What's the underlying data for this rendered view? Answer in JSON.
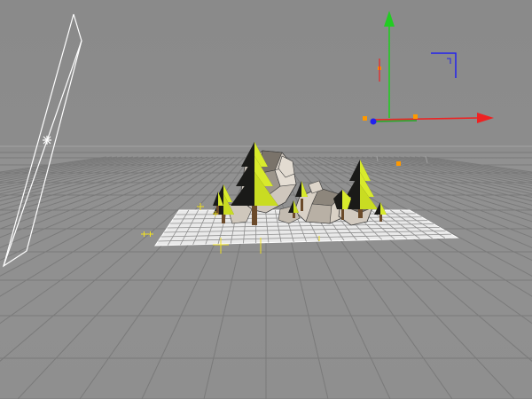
{
  "viewport": {
    "name": "3d-perspective-viewport",
    "background": "#8d8d8d",
    "grid_color": "#777777",
    "horizon_color": "#a0a0a0"
  },
  "scene": {
    "objects": [
      "camera-frustum",
      "ground-plane-mesh",
      "low-poly-trees",
      "low-poly-rocks",
      "light-handles"
    ],
    "tree_colors": {
      "yellow": "#d8ea2c",
      "dark": "#1a1a18",
      "trunk": "#6b4a2a"
    },
    "rock_colors": {
      "light": "#d8d0c6",
      "shade": "#6e6a64"
    }
  },
  "gizmo": {
    "x_axis_color": "#ee2222",
    "y_axis_color": "#22cc22",
    "z_axis_color": "#2222ee",
    "handle_color": "#ff9900"
  }
}
